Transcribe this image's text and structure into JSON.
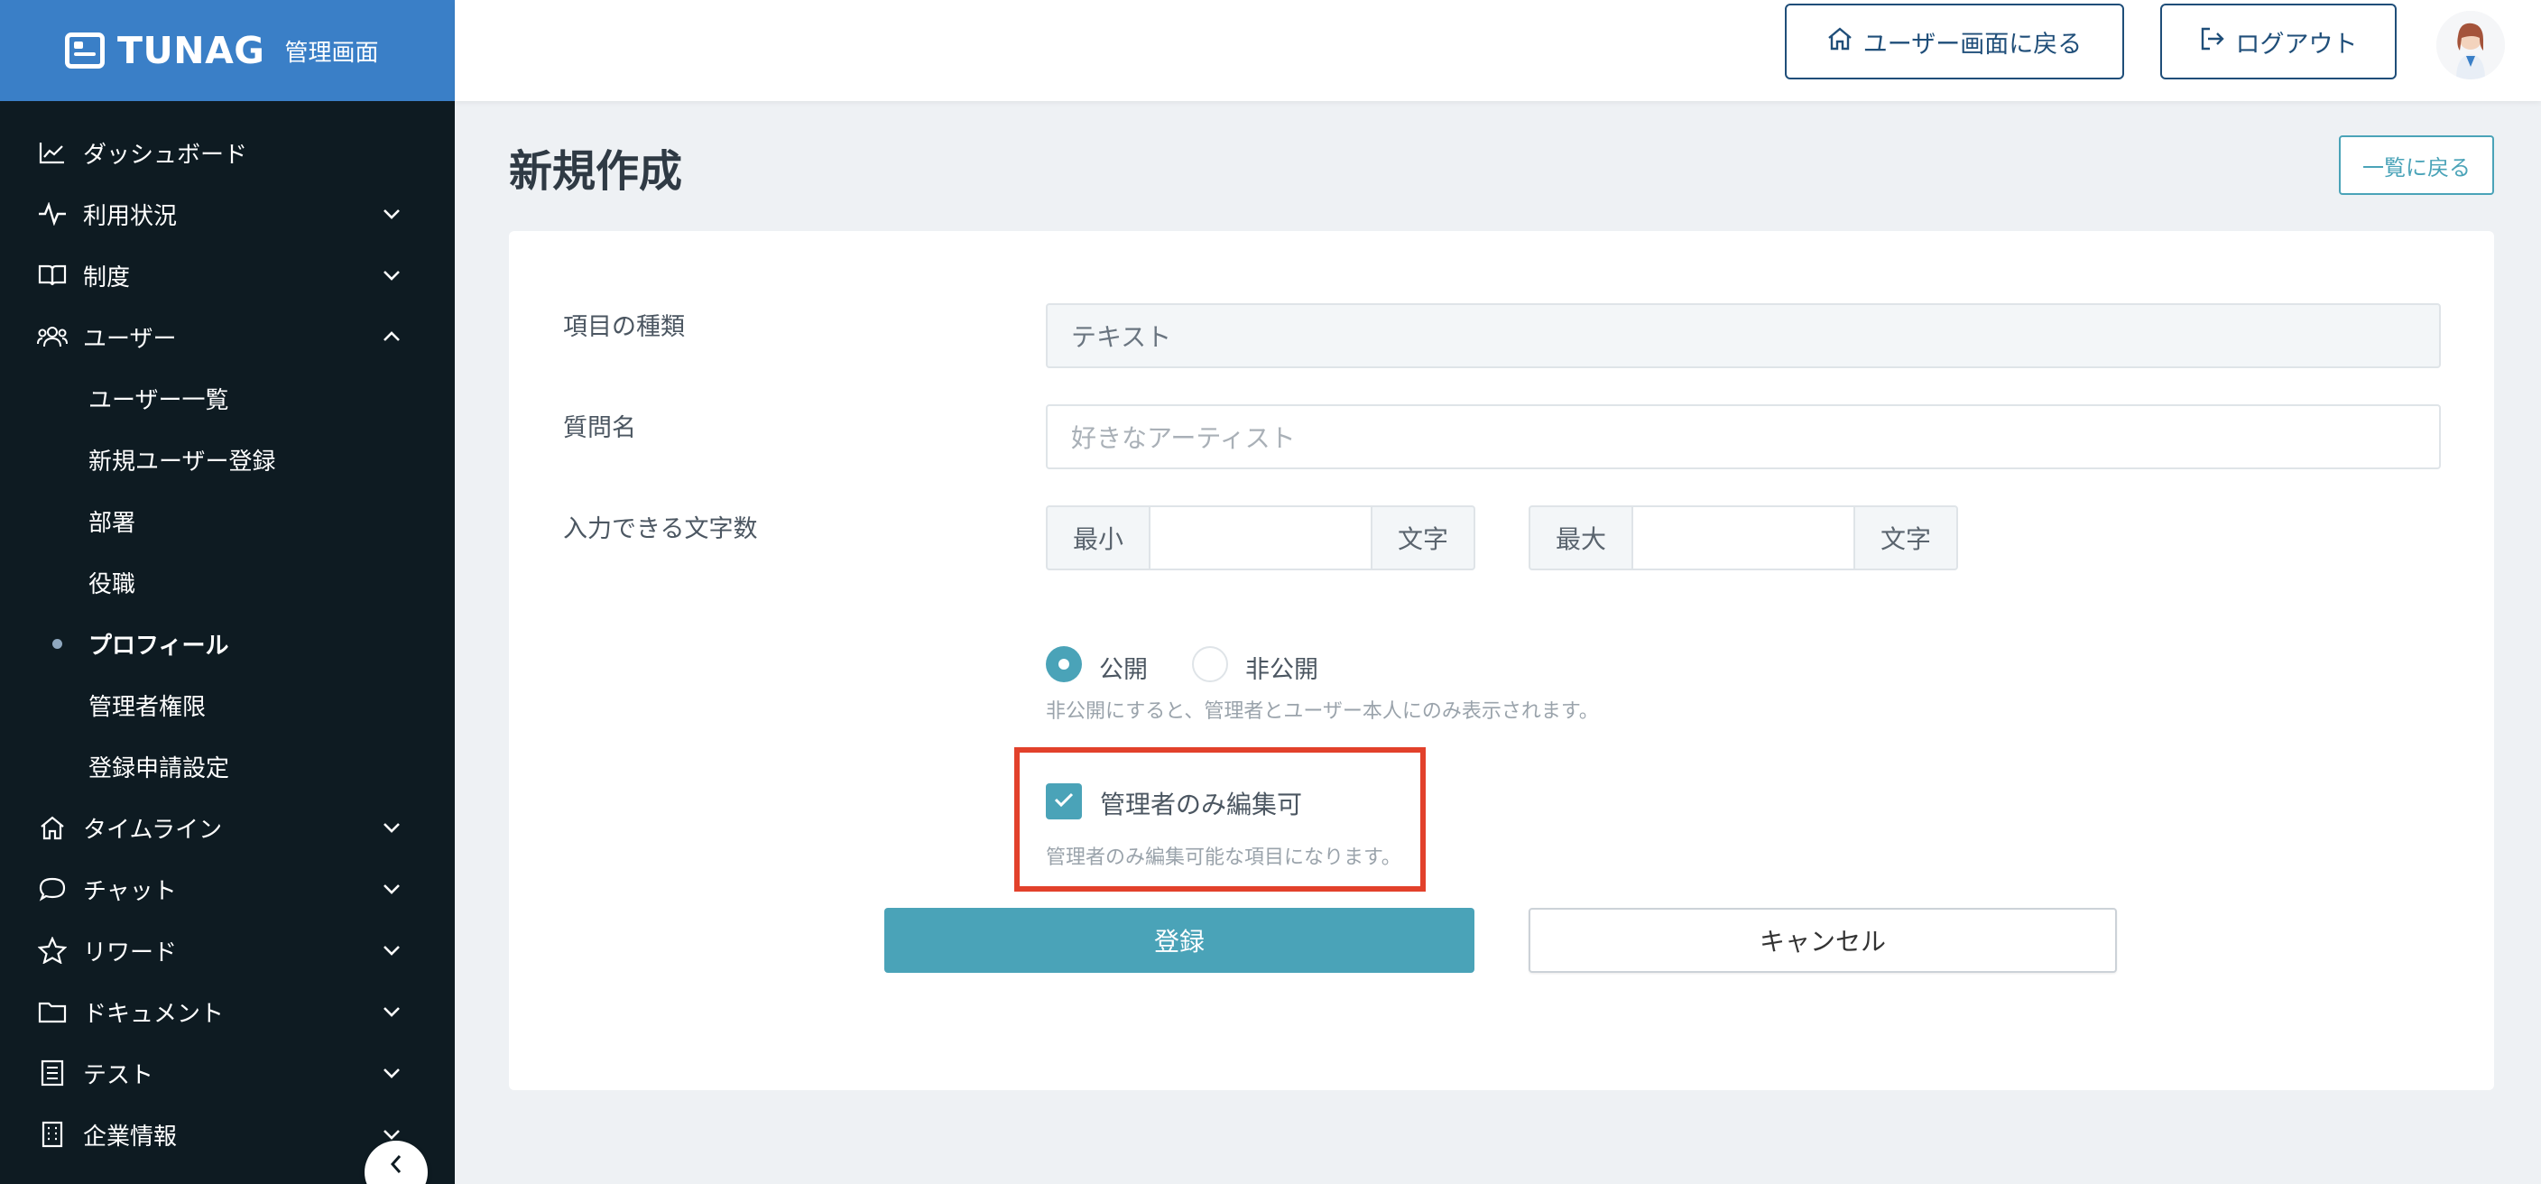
{
  "brand": {
    "name": "TUNAG",
    "sub": "管理画面"
  },
  "sidebar": {
    "items": [
      {
        "label": "ダッシュボード",
        "icon": "chart-line-icon"
      },
      {
        "label": "利用状況",
        "icon": "activity-pulse-icon"
      },
      {
        "label": "制度",
        "icon": "book-open-icon"
      },
      {
        "label": "ユーザー",
        "icon": "users-icon"
      },
      {
        "label": "タイムライン",
        "icon": "home-icon"
      },
      {
        "label": "チャット",
        "icon": "chat-bubble-icon"
      },
      {
        "label": "リワード",
        "icon": "star-icon"
      },
      {
        "label": "ドキュメント",
        "icon": "folder-icon"
      },
      {
        "label": "テスト",
        "icon": "checklist-icon"
      },
      {
        "label": "企業情報",
        "icon": "building-icon"
      }
    ],
    "user_subitems": [
      "ユーザー一覧",
      "新規ユーザー登録",
      "部署",
      "役職",
      "プロフィール",
      "管理者権限",
      "登録申請設定"
    ],
    "active_subitem": "プロフィール"
  },
  "header": {
    "back_to_user_label": "ユーザー画面に戻る",
    "logout_label": "ログアウト"
  },
  "page": {
    "title": "新規作成",
    "back_to_list_label": "一覧に戻る"
  },
  "form": {
    "item_type": {
      "label": "項目の種類",
      "value": "テキスト"
    },
    "question_name": {
      "label": "質問名",
      "placeholder": "好きなアーティスト"
    },
    "char_count": {
      "label": "入力できる文字数",
      "min_label": "最小",
      "max_label": "最大",
      "unit": "文字",
      "min_value": "",
      "max_value": ""
    },
    "visibility": {
      "public_label": "公開",
      "private_label": "非公開",
      "selected": "公開",
      "hint": "非公開にすると、管理者とユーザー本人にのみ表示されます。"
    },
    "admin_only": {
      "label": "管理者のみ編集可",
      "checked": true,
      "hint": "管理者のみ編集可能な項目になります。"
    },
    "submit_label": "登録",
    "cancel_label": "キャンセル"
  },
  "colors": {
    "sidebar_bg": "#0e1b22",
    "brand_bg": "#3a7fc7",
    "accent": "#4aa3b8",
    "header_btn": "#1f4e79",
    "highlight": "#e2412b"
  }
}
